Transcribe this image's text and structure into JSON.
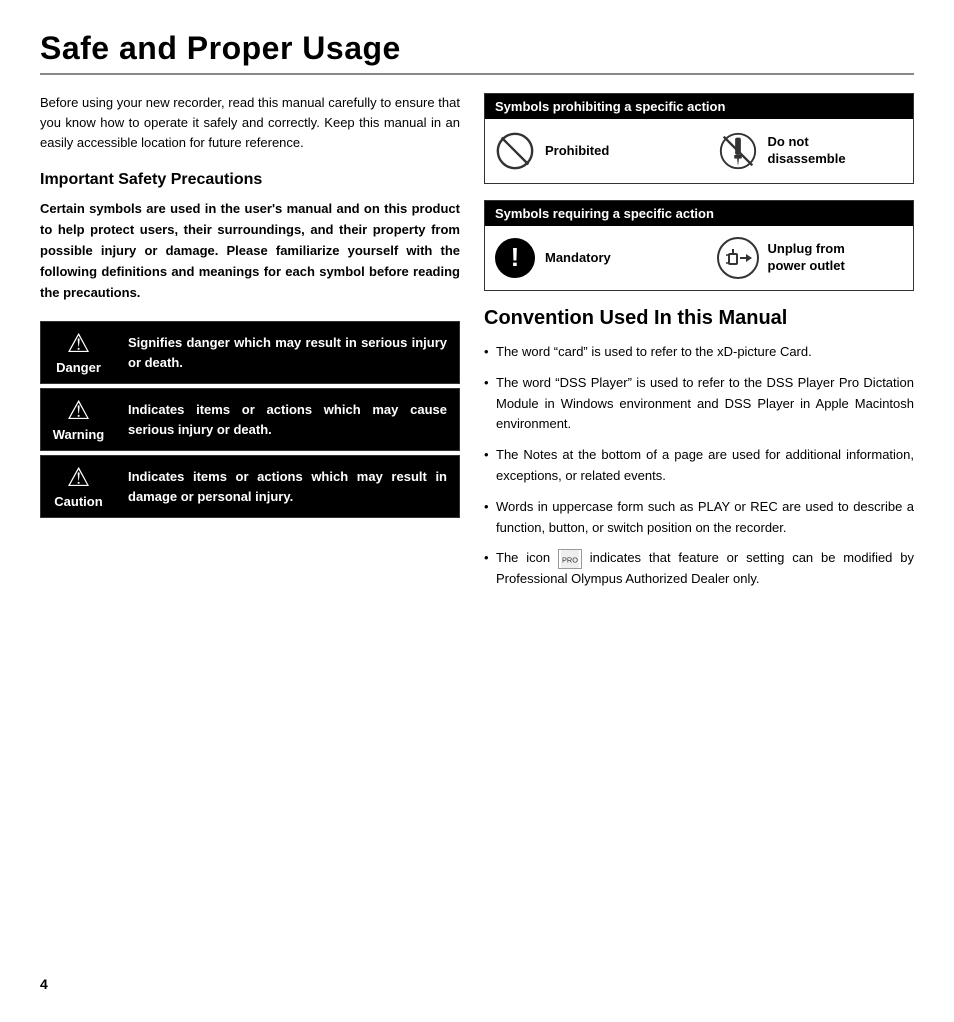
{
  "page": {
    "title": "Safe and Proper Usage",
    "page_number": "4"
  },
  "left": {
    "intro": "Before using your new recorder, read this manual carefully to ensure that you know how to operate it safely and correctly. Keep this manual in an easily accessible location for future reference.",
    "safety_heading": "Important Safety Precautions",
    "safety_body": "Certain symbols are used in the user's manual and on this product to help protect users, their surroundings, and their property from possible injury or damage. Please familiarize yourself with the following definitions and meanings for each symbol before reading the precautions.",
    "boxes": [
      {
        "label": "Danger",
        "text": "Signifies danger which may result in serious injury or death."
      },
      {
        "label": "Warning",
        "text": "Indicates items or actions which may cause serious injury or death."
      },
      {
        "label": "Caution",
        "text": "Indicates items or actions which may result in damage or personal injury."
      }
    ]
  },
  "right": {
    "symbols_prohibit_header": "Symbols prohibiting a specific action",
    "symbols_prohibit": [
      {
        "label": "Prohibited"
      },
      {
        "label": "Do not\ndisassemble"
      }
    ],
    "symbols_require_header": "Symbols requiring a specific action",
    "symbols_require": [
      {
        "label": "Mandatory"
      },
      {
        "label": "Unplug from\npower outlet"
      }
    ],
    "convention_heading": "Convention Used In this Manual",
    "convention_items": [
      "The word “card” is used to refer to the xD-picture Card.",
      "The word “DSS Player” is used to refer to the DSS Player Pro Dictation Module in Windows environment and DSS Player in Apple Macintosh environment.",
      "The Notes at the bottom of a page are used for additional information, exceptions, or related events.",
      "Words in uppercase form such as PLAY or REC are used to describe a function, button, or switch position on the recorder.",
      "The icon    indicates that feature or setting can be modified by Professional Olympus Authorized Dealer only."
    ]
  }
}
